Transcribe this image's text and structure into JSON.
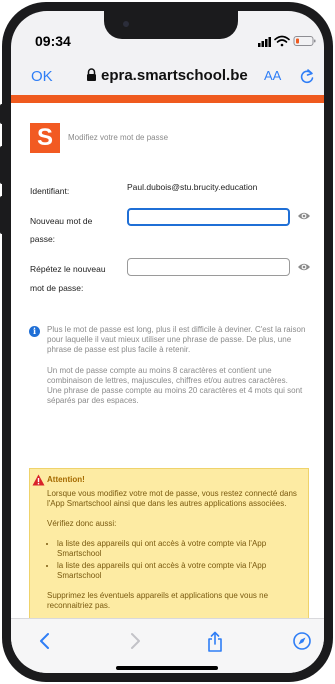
{
  "status_bar": {
    "time": "09:34"
  },
  "browser": {
    "done_label": "OK",
    "domain": "epra.smartschool.be",
    "text_size_label": "AA"
  },
  "colors": {
    "brand_orange": "#ef5a1e",
    "link_blue": "#2f7ef6",
    "warning_bg": "#fdeba3",
    "warning_text": "#a56a00"
  },
  "page": {
    "logo_letter": "S",
    "header_subtitle": "Modifiez votre mot de passe",
    "identifier_label": "Identifiant:",
    "identifier_value": "Paul.dubois@stu.brucity.education",
    "new_password_label_1": "Nouveau mot de",
    "new_password_label_2": "passe:",
    "new_password_value": "",
    "repeat_password_label_1": "Répétez le nouveau",
    "repeat_password_label_2": "mot de passe:",
    "repeat_password_value": "",
    "info_paragraph_1": "Plus le mot de passe est long, plus il est difficile à deviner. C'est la raison pour laquelle il vaut mieux utiliser une phrase de passe. De plus, une phrase de passe est plus facile à retenir.",
    "info_paragraph_2a": "Un mot de passe compte au moins 8 caractères et contient une combinaison de lettres, majuscules, chiffres et/ou autres caractères.",
    "info_paragraph_2b": "Une phrase de passe compte au moins 20 caractères et 4 mots qui sont séparés par des espaces.",
    "warning_title": "Attention!",
    "warning_paragraph_1": "Lorsque vous modifiez votre mot de passe, vous restez connecté dans l'App Smartschool ainsi que dans les autres applications associées.",
    "warning_paragraph_2": "Vérifiez donc aussi:",
    "warning_list": [
      "la liste des appareils qui ont accès à votre compte via l'App Smartschool",
      "la liste des appareils qui ont accès à votre compte via l'App Smartschool"
    ],
    "warning_paragraph_3": "Supprimez les éventuels appareils et applications que vous ne reconnaitriez pas."
  },
  "toolbar_icons": [
    "back-icon",
    "forward-icon",
    "share-icon",
    "compass-icon"
  ]
}
